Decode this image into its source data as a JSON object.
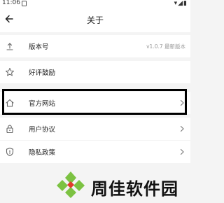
{
  "status_bar": {
    "time": "11:06",
    "right_icons": "▾◢▮"
  },
  "app_bar": {
    "title": "关于"
  },
  "settings": {
    "items": [
      {
        "label": "版本号",
        "value": "v1.0.7 最新版本",
        "icon": "upload-icon"
      },
      {
        "label": "好评鼓励",
        "icon": "star-icon"
      },
      {
        "label": "官方网站",
        "icon": "home-icon"
      },
      {
        "label": "用户协议",
        "icon": "lock-icon"
      },
      {
        "label": "隐私政策",
        "icon": "shield-icon"
      }
    ]
  },
  "watermark": {
    "text": "周佳软件园",
    "colors": {
      "green": "#7cc242",
      "red": "#e23b2e",
      "dark": "#111111"
    }
  }
}
